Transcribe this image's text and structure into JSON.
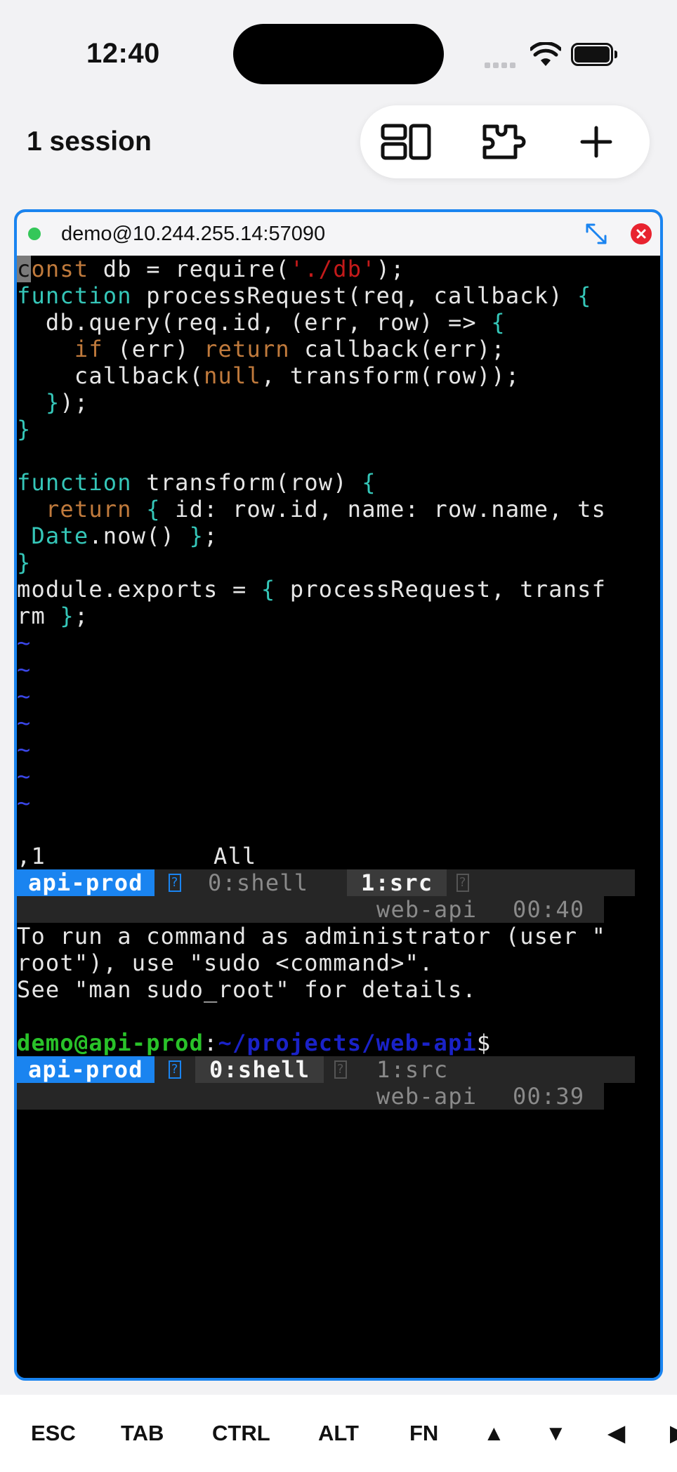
{
  "status_bar": {
    "time": "12:40"
  },
  "header": {
    "session_count": "1 session"
  },
  "toolbar": {
    "icons": [
      "split-view-icon",
      "plugin-icon",
      "plus-icon"
    ]
  },
  "terminal": {
    "title": "demo@10.244.255.14:57090",
    "vim": {
      "lines": [
        [
          "c",
          "onst",
          " db = require(",
          "'./db'",
          ");"
        ],
        [
          "function",
          " processRequest(req, callback) ",
          "{"
        ],
        [
          "  db.query(req.id, (err, row) => ",
          "{"
        ],
        [
          "    ",
          "if",
          " (err) ",
          "return",
          " callback(err);"
        ],
        [
          "    callback(",
          "null",
          ", transform(row));"
        ],
        [
          "  ",
          "}",
          ");"
        ],
        [
          "}"
        ],
        [
          ""
        ],
        [
          "function",
          " transform(row) ",
          "{"
        ],
        [
          "  ",
          "return",
          " ",
          "{",
          " id: row.id, name: row.name, ts"
        ],
        [
          " ",
          "Date",
          ".now() ",
          "}",
          ";"
        ],
        [
          "}"
        ],
        [
          "module.exports = ",
          "{",
          " processRequest, transf"
        ],
        [
          "rm ",
          "}",
          ";"
        ]
      ],
      "tildes": [
        "~",
        "~",
        "~",
        "~",
        "~",
        "~",
        "~"
      ],
      "status_left": ",1",
      "status_right": "All"
    },
    "tmux_top": {
      "session": "api-prod",
      "win0": "0:shell",
      "win1": "1:src",
      "host": "web-api",
      "time": "00:40"
    },
    "shell": {
      "lines": [
        "To run a command as administrator (user \"",
        "root\"), use \"sudo <command>\".",
        "See \"man sudo_root\" for details."
      ],
      "prompt_user": "demo@api-prod",
      "prompt_sep": ":",
      "prompt_path": "~/projects/web-api",
      "prompt_sym": "$"
    },
    "tmux_bottom": {
      "session": "api-prod",
      "win0": "0:shell",
      "win1": "1:src",
      "host": "web-api",
      "time": "00:39"
    }
  },
  "keys": [
    "ESC",
    "TAB",
    "CTRL",
    "ALT",
    "FN",
    "▲",
    "▼",
    "◀",
    "▶"
  ],
  "colors": {
    "accent": "#1a84f0",
    "close": "#e8232f",
    "online": "#34c759"
  }
}
